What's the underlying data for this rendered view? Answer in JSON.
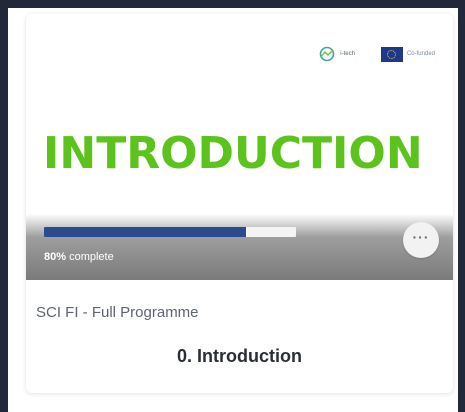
{
  "card": {
    "thumbnail": {
      "title": "INTRODUCTION",
      "title_color": "#5cc21c",
      "logos": {
        "partner_text": "i-tech",
        "eu_text": "Co-funded"
      }
    },
    "progress": {
      "percent": 80,
      "percent_label": "80%",
      "suffix_label": " complete",
      "fill_color": "#2c4a8e"
    },
    "menu": {
      "icon": "more-options-icon",
      "label": "···"
    },
    "category": "SCI FI - Full Programme",
    "course_name": "0. Introduction"
  }
}
